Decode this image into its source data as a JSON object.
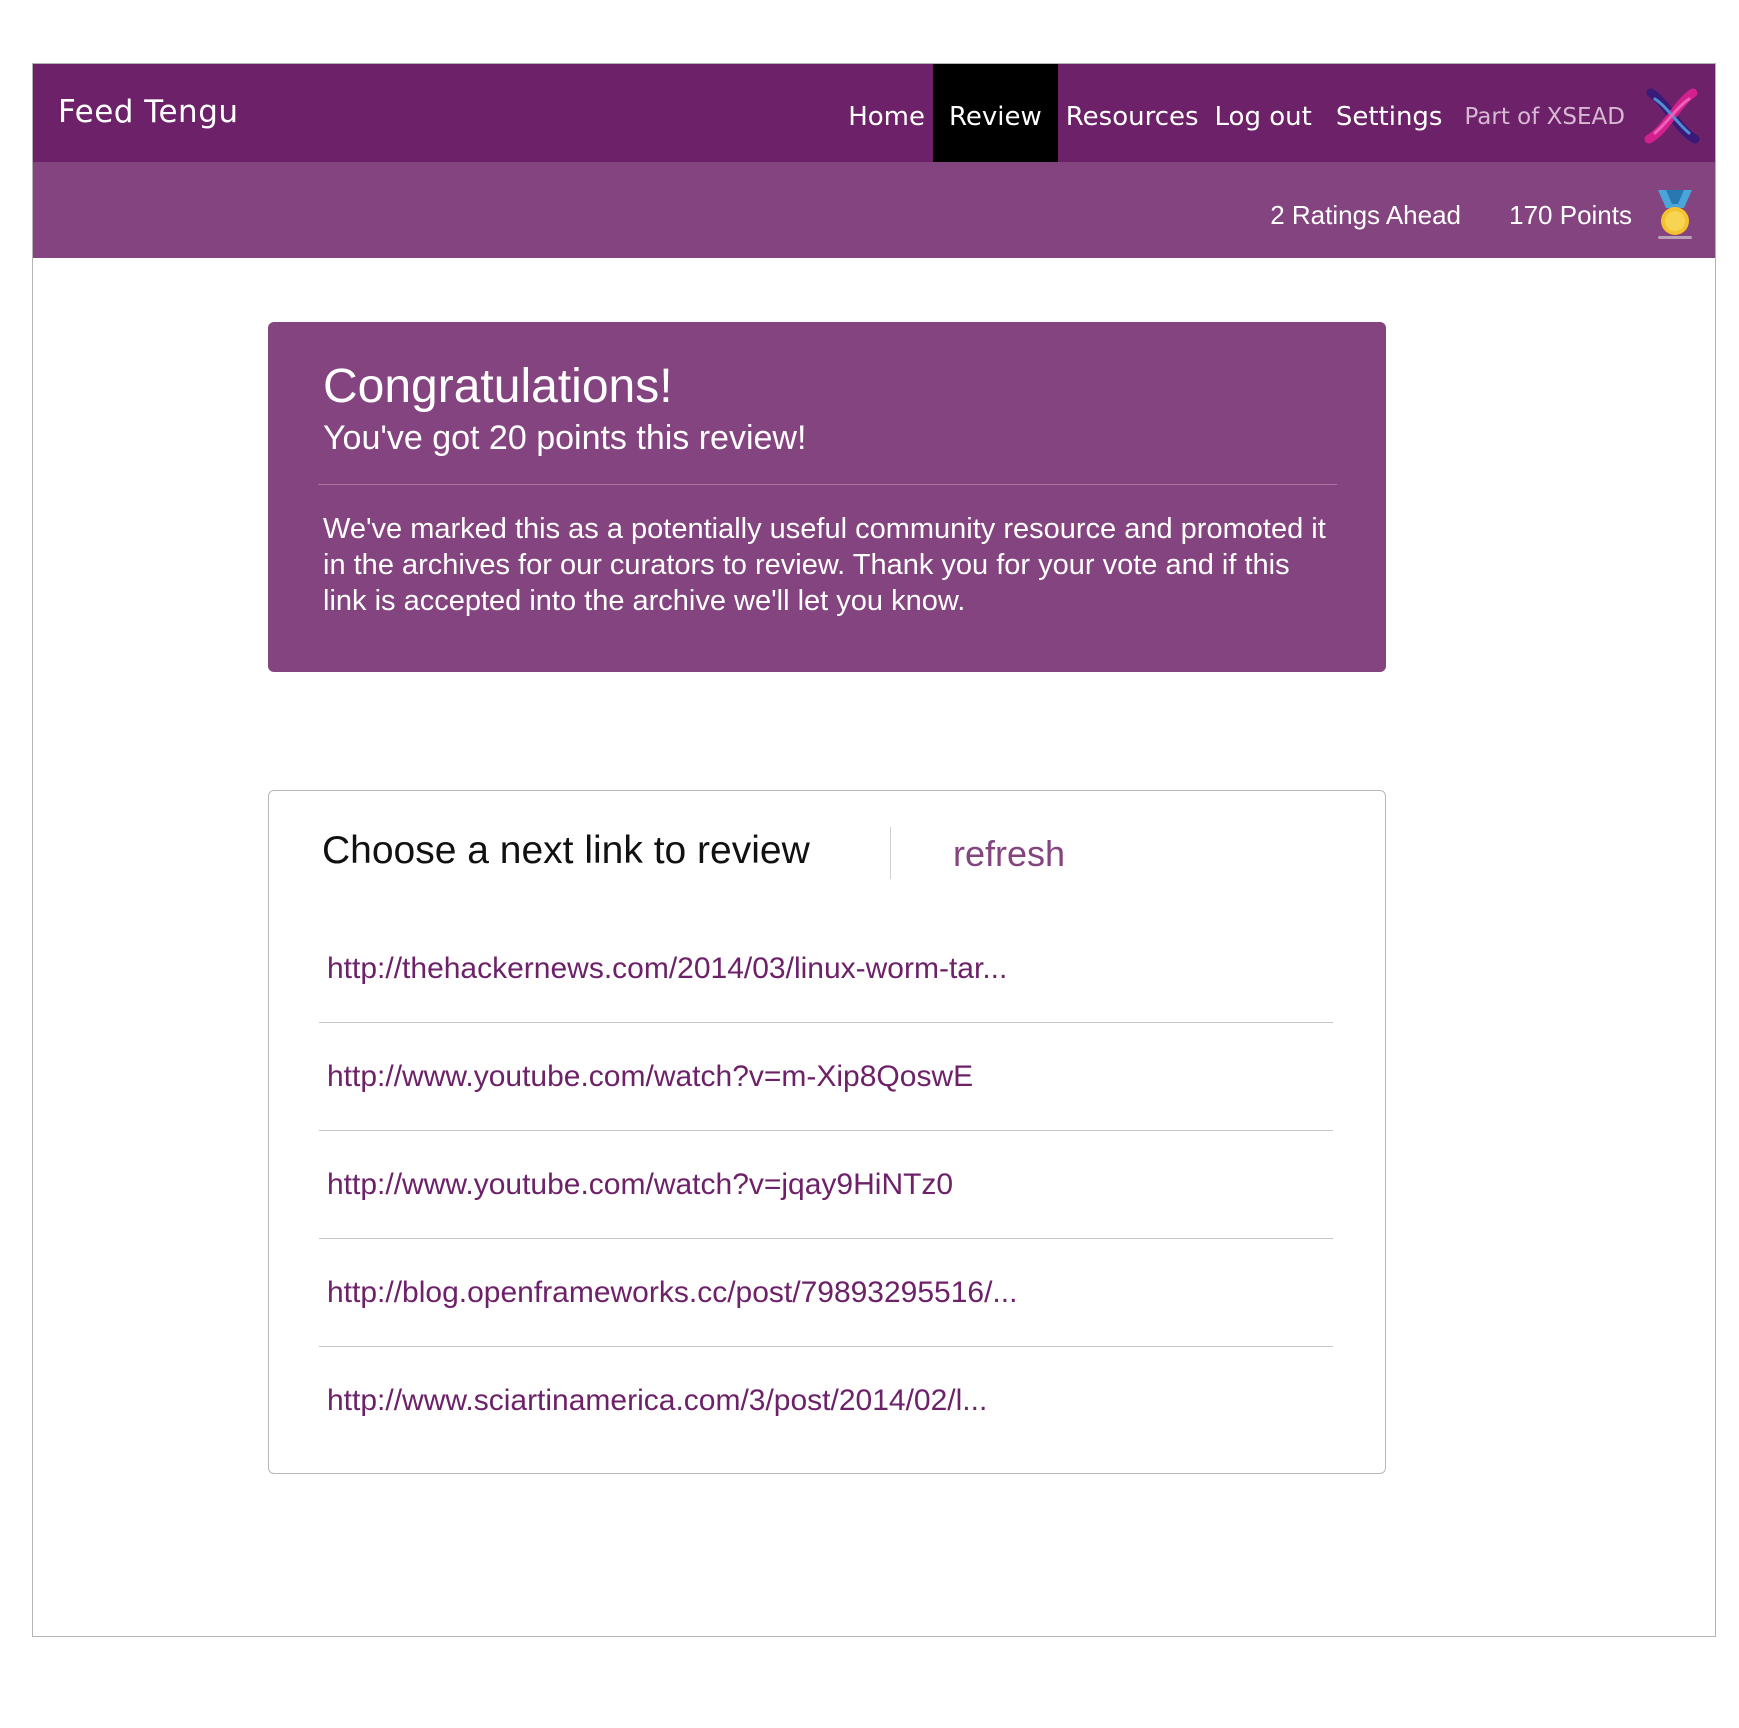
{
  "header": {
    "brand": "Feed Tengu",
    "nav": [
      {
        "label": "Home",
        "active": false
      },
      {
        "label": "Review",
        "active": true
      },
      {
        "label": "Resources",
        "active": false
      },
      {
        "label": "Log out",
        "active": false
      },
      {
        "label": "Settings",
        "active": false
      }
    ],
    "part_of": "Part of XSEAD",
    "logo_icon": "xsead-logo-icon"
  },
  "status": {
    "ratings_ahead": "2 Ratings Ahead",
    "points": "170 Points",
    "medal_icon": "medal-icon"
  },
  "congrats": {
    "title": "Congratulations!",
    "subtitle": "You've got 20 points this review!",
    "body": "We've marked this as a potentially useful community resource and promoted it in the archives for our curators to review. Thank you for your vote and if this link is accepted into the archive we'll let you know."
  },
  "next_links": {
    "title": "Choose a next link to review",
    "refresh_label": "refresh",
    "links": [
      "http://thehackernews.com/2014/03/linux-worm-tar...",
      "http://www.youtube.com/watch?v=m-Xip8QoswE",
      "http://www.youtube.com/watch?v=jqay9HiNTz0",
      "http://blog.openframeworks.cc/post/79893295516/...",
      "http://www.sciartinamerica.com/3/post/2014/02/l..."
    ]
  },
  "colors": {
    "primary": "#6d2168",
    "secondary": "#84447f",
    "active_nav": "#000000"
  }
}
